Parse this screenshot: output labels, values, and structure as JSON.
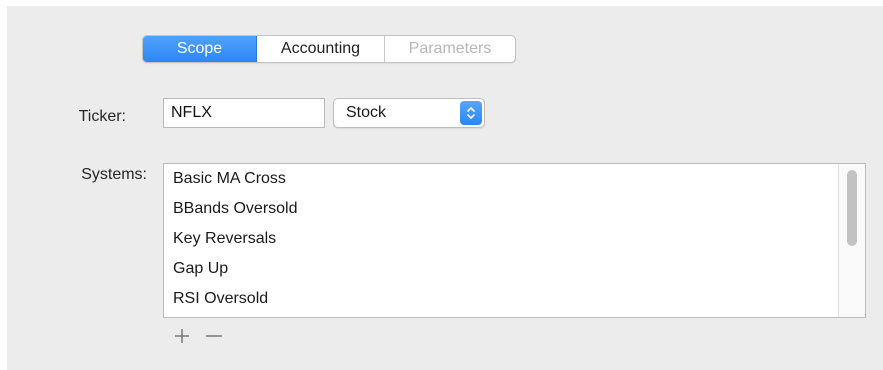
{
  "tabs": [
    {
      "label": "Scope",
      "state": "selected"
    },
    {
      "label": "Accounting",
      "state": "normal"
    },
    {
      "label": "Parameters",
      "state": "disabled"
    }
  ],
  "ticker": {
    "label": "Ticker:",
    "value": "NFLX"
  },
  "security_type": {
    "selected": "Stock"
  },
  "systems": {
    "label": "Systems:",
    "items": [
      "Basic MA Cross",
      "BBands Oversold",
      "Key Reversals",
      "Gap Up",
      "RSI Oversold"
    ],
    "add_icon": "plus-icon",
    "remove_icon": "minus-icon"
  },
  "colors": {
    "accent": "#2d86f5",
    "background": "#ececec"
  }
}
